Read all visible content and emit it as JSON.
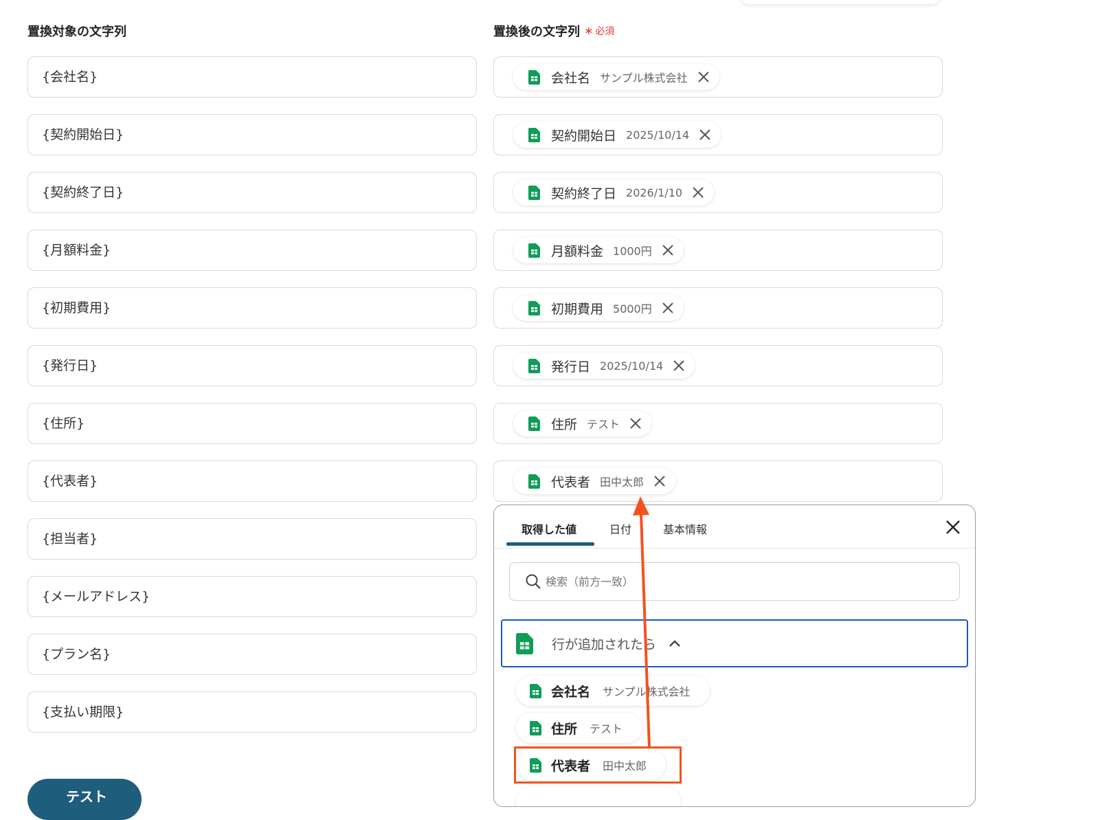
{
  "labels": {
    "target": "置換対象の文字列",
    "replacement": "置換後の文字列",
    "required_mark": "∗",
    "required": "必須"
  },
  "targets": [
    "{会社名}",
    "{契約開始日}",
    "{契約終了日}",
    "{月額料金}",
    "{初期費用}",
    "{発行日}",
    "{住所}",
    "{代表者}",
    "{担当者}",
    "{メールアドレス}",
    "{プラン名}",
    "{支払い期限}"
  ],
  "replacements": [
    {
      "name": "会社名",
      "value": "サンプル株式会社"
    },
    {
      "name": "契約開始日",
      "value": "2025/10/14"
    },
    {
      "name": "契約終了日",
      "value": "2026/1/10"
    },
    {
      "name": "月額料金",
      "value": "1000円"
    },
    {
      "name": "初期費用",
      "value": "5000円"
    },
    {
      "name": "発行日",
      "value": "2025/10/14"
    },
    {
      "name": "住所",
      "value": "テスト"
    },
    {
      "name": "代表者",
      "value": "田中太郎"
    }
  ],
  "popup": {
    "tabs": [
      "取得した値",
      "日付",
      "基本情報"
    ],
    "search_placeholder": "検索（前方一致）",
    "group_label": "行が追加されたら",
    "options": [
      {
        "name": "会社名",
        "value": "サンプル株式会社"
      },
      {
        "name": "住所",
        "value": "テスト"
      },
      {
        "name": "代表者",
        "value": "田中太郎"
      }
    ]
  },
  "buttons": {
    "test": "テスト"
  },
  "colors": {
    "accent": "#1f5d7c",
    "required": "#e53935",
    "annotation": "#f4511e",
    "selection_border": "#1a56c8",
    "sheets_green": "#0f9d58"
  },
  "icons": {
    "chip": "google-sheets-icon",
    "remove": "close-icon",
    "search": "search-icon",
    "collapse": "chevron-up-icon"
  }
}
